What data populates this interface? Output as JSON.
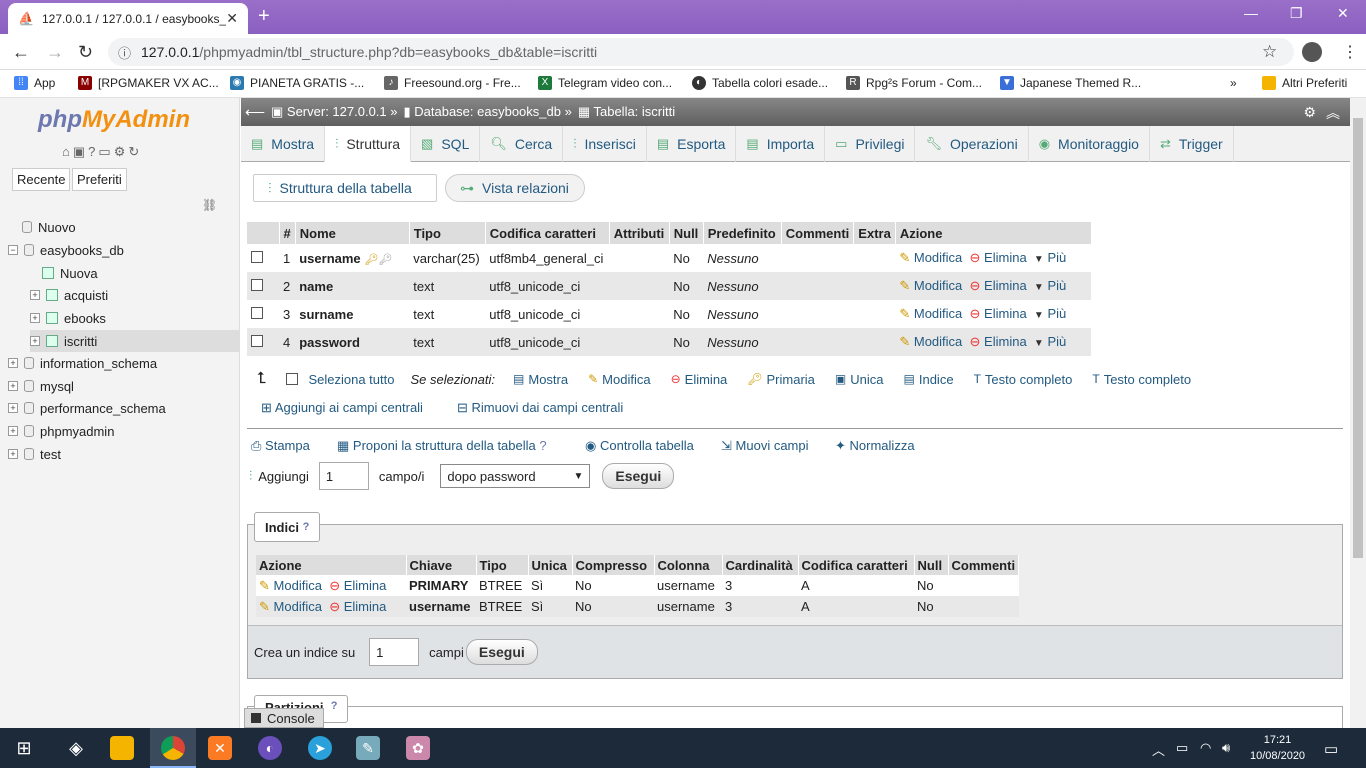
{
  "browser": {
    "tab_title": "127.0.0.1 / 127.0.0.1 / easybooks_",
    "url_host": "127.0.0.1",
    "url_path": "/phpmyadmin/tbl_structure.php?db=easybooks_db&table=iscritti",
    "bookmarks": [
      "App",
      "[RPGMAKER VX AC...",
      "PIANETA GRATIS -...",
      "Freesound.org - Fre...",
      "Telegram video con...",
      "Tabella colori esade...",
      "Rpg²s Forum - Com...",
      "Japanese Themed R...",
      "Altri Preferiti"
    ],
    "bookmarks_more": "»"
  },
  "sidebar": {
    "logo_php": "php",
    "logo_myadmin": "MyAdmin",
    "recent": "Recente",
    "favorites": "Preferiti",
    "tree": [
      {
        "label": "Nuovo",
        "level": 0,
        "kind": "new"
      },
      {
        "label": "easybooks_db",
        "level": 0,
        "kind": "db-open"
      },
      {
        "label": "Nuova",
        "level": 1,
        "kind": "new"
      },
      {
        "label": "acquisti",
        "level": 1,
        "kind": "table"
      },
      {
        "label": "ebooks",
        "level": 1,
        "kind": "table"
      },
      {
        "label": "iscritti",
        "level": 1,
        "kind": "table",
        "selected": true
      },
      {
        "label": "information_schema",
        "level": 0,
        "kind": "db"
      },
      {
        "label": "mysql",
        "level": 0,
        "kind": "db"
      },
      {
        "label": "performance_schema",
        "level": 0,
        "kind": "db"
      },
      {
        "label": "phpmyadmin",
        "level": 0,
        "kind": "db"
      },
      {
        "label": "test",
        "level": 0,
        "kind": "db"
      }
    ]
  },
  "breadcrumb": {
    "server": "Server: 127.0.0.1 »",
    "database": "Database: easybooks_db »",
    "table": "Tabella: iscritti"
  },
  "tabs": [
    "Mostra",
    "Struttura",
    "SQL",
    "Cerca",
    "Inserisci",
    "Esporta",
    "Importa",
    "Privilegi",
    "Operazioni",
    "Monitoraggio",
    "Trigger"
  ],
  "active_tab": "Struttura",
  "subtabs": [
    "Struttura della tabella",
    "Vista relazioni"
  ],
  "structure": {
    "headers": [
      "#",
      "Nome",
      "Tipo",
      "Codifica caratteri",
      "Attributi",
      "Null",
      "Predefinito",
      "Commenti",
      "Extra",
      "Azione"
    ],
    "rows": [
      {
        "n": "1",
        "name": "username",
        "type": "varchar(25)",
        "coll": "utf8mb4_general_ci",
        "null": "No",
        "default": "Nessuno"
      },
      {
        "n": "2",
        "name": "name",
        "type": "text",
        "coll": "utf8_unicode_ci",
        "null": "No",
        "default": "Nessuno"
      },
      {
        "n": "3",
        "name": "surname",
        "type": "text",
        "coll": "utf8_unicode_ci",
        "null": "No",
        "default": "Nessuno"
      },
      {
        "n": "4",
        "name": "password",
        "type": "text",
        "coll": "utf8_unicode_ci",
        "null": "No",
        "default": "Nessuno"
      }
    ],
    "actions": [
      "Modifica",
      "Elimina",
      "Più"
    ]
  },
  "bulk": {
    "select_all": "Seleziona tutto",
    "with_selected": "Se selezionati:",
    "actions": [
      "Mostra",
      "Modifica",
      "Elimina",
      "Primaria",
      "Unica",
      "Indice",
      "Testo completo",
      "Testo completo"
    ],
    "add_central": "Aggiungi ai campi centrali",
    "remove_central": "Rimuovi dai campi centrali"
  },
  "ops": [
    "Stampa",
    "Proponi la struttura della tabella",
    "Controlla tabella",
    "Muovi campi",
    "Normalizza"
  ],
  "add_field": {
    "label": "Aggiungi",
    "count": "1",
    "unit": "campo/i",
    "position": "dopo password",
    "go": "Esegui"
  },
  "indexes": {
    "legend": "Indici",
    "headers": [
      "Azione",
      "Chiave",
      "Tipo",
      "Unica",
      "Compresso",
      "Colonna",
      "Cardinalità",
      "Codifica caratteri",
      "Null",
      "Commenti"
    ],
    "rows": [
      {
        "key": "PRIMARY",
        "type": "BTREE",
        "unique": "Sì",
        "packed": "No",
        "column": "username",
        "card": "3",
        "coll": "A",
        "null": "No",
        "comment": ""
      },
      {
        "key": "username",
        "type": "BTREE",
        "unique": "Sì",
        "packed": "No",
        "column": "username",
        "card": "3",
        "coll": "A",
        "null": "No",
        "comment": ""
      }
    ],
    "edit": "Modifica",
    "drop": "Elimina",
    "create_label": "Crea un indice su",
    "create_count": "1",
    "create_unit": "campi",
    "create_go": "Esegui"
  },
  "partitions_legend": "Partizioni",
  "console": "Console",
  "clock": {
    "time": "17:21",
    "date": "10/08/2020"
  }
}
